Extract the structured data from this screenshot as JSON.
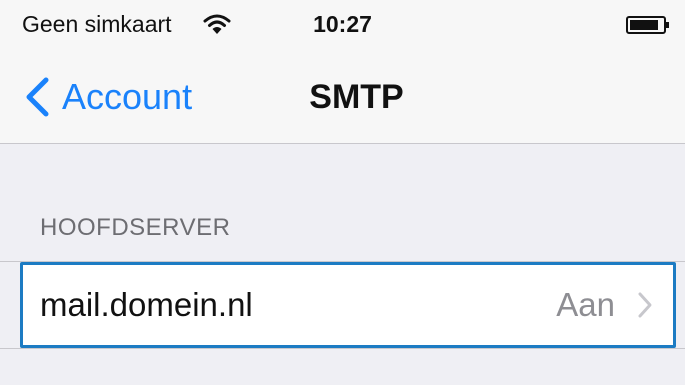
{
  "status_bar": {
    "carrier": "Geen simkaart",
    "time": "10:27",
    "icons": [
      "wifi-icon",
      "battery-icon"
    ]
  },
  "nav": {
    "back_label": "Account",
    "back_icon": "chevron-left-icon",
    "title": "SMTP"
  },
  "section": {
    "header": "HOOFDSERVER",
    "server": {
      "name": "mail.domein.nl",
      "status": "Aan",
      "icon": "chevron-right-icon"
    }
  },
  "colors": {
    "accent": "#1a82fb",
    "selection_border": "#1c7bc3",
    "background": "#efeff4",
    "secondary_text": "#8e8e93"
  }
}
